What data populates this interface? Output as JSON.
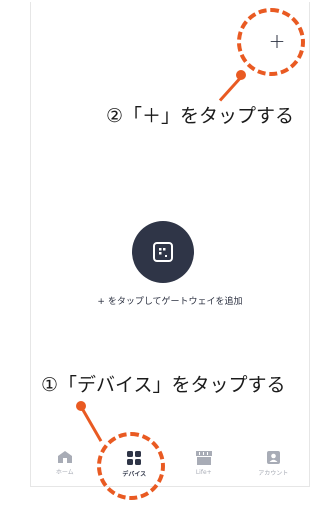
{
  "header": {
    "add_button_label": "+"
  },
  "main": {
    "empty_text": "+ をタップしてゲートウェイを追加"
  },
  "annotations": {
    "step2": "②「＋」をタップする",
    "step1": "①「デバイス」をタップする"
  },
  "tabbar": {
    "tabs": [
      {
        "label": "ホーム",
        "icon": "home-icon",
        "active": false
      },
      {
        "label": "デバイス",
        "icon": "grid-icon",
        "active": true
      },
      {
        "label": "Life+",
        "icon": "store-icon",
        "active": false
      },
      {
        "label": "アカウント",
        "icon": "account-icon",
        "active": false
      }
    ]
  },
  "colors": {
    "accent": "#e95a22",
    "dark": "#2f3547",
    "inactive": "#a8acb6"
  }
}
